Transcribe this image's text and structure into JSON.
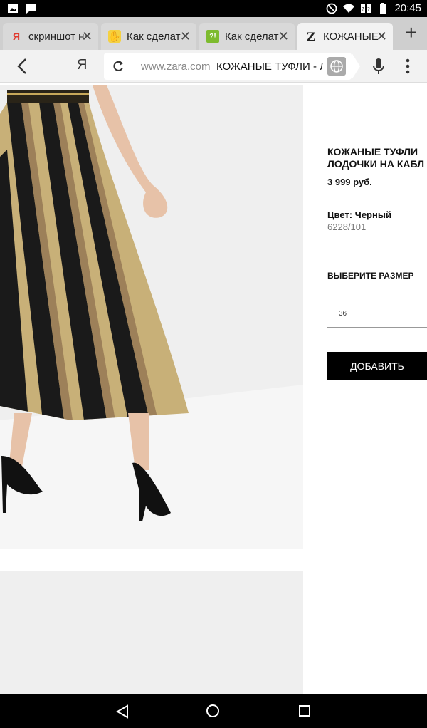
{
  "status_bar": {
    "time": "20:45"
  },
  "tabs": [
    {
      "label": "скриншот н",
      "favicon": "yandex-icon"
    },
    {
      "label": "Как сделат",
      "favicon": "hand-icon"
    },
    {
      "label": "Как сделат",
      "favicon": "question-icon"
    },
    {
      "label": "КОЖАНЫЕ",
      "favicon": "zara-icon",
      "active": true
    }
  ],
  "address_bar": {
    "ya": "Я",
    "domain": "www.zara.com",
    "title": "КОЖАНЫЕ ТУФЛИ - ЛО"
  },
  "product": {
    "title": "КОЖАНЫЕ ТУФЛИ ЛОДОЧКИ НА КАБЛ",
    "price": "3 999 руб.",
    "color": "Цвет: Черный",
    "ref": "6228/101",
    "size_label": "ВЫБЕРИТЕ РАЗМЕР",
    "size_value": "36",
    "add_button": "ДОБАВИТЬ"
  },
  "colors": {
    "stripe_gold": "#c8b078",
    "stripe_black": "#1a1a1a",
    "photo_bg": "#efefef"
  }
}
